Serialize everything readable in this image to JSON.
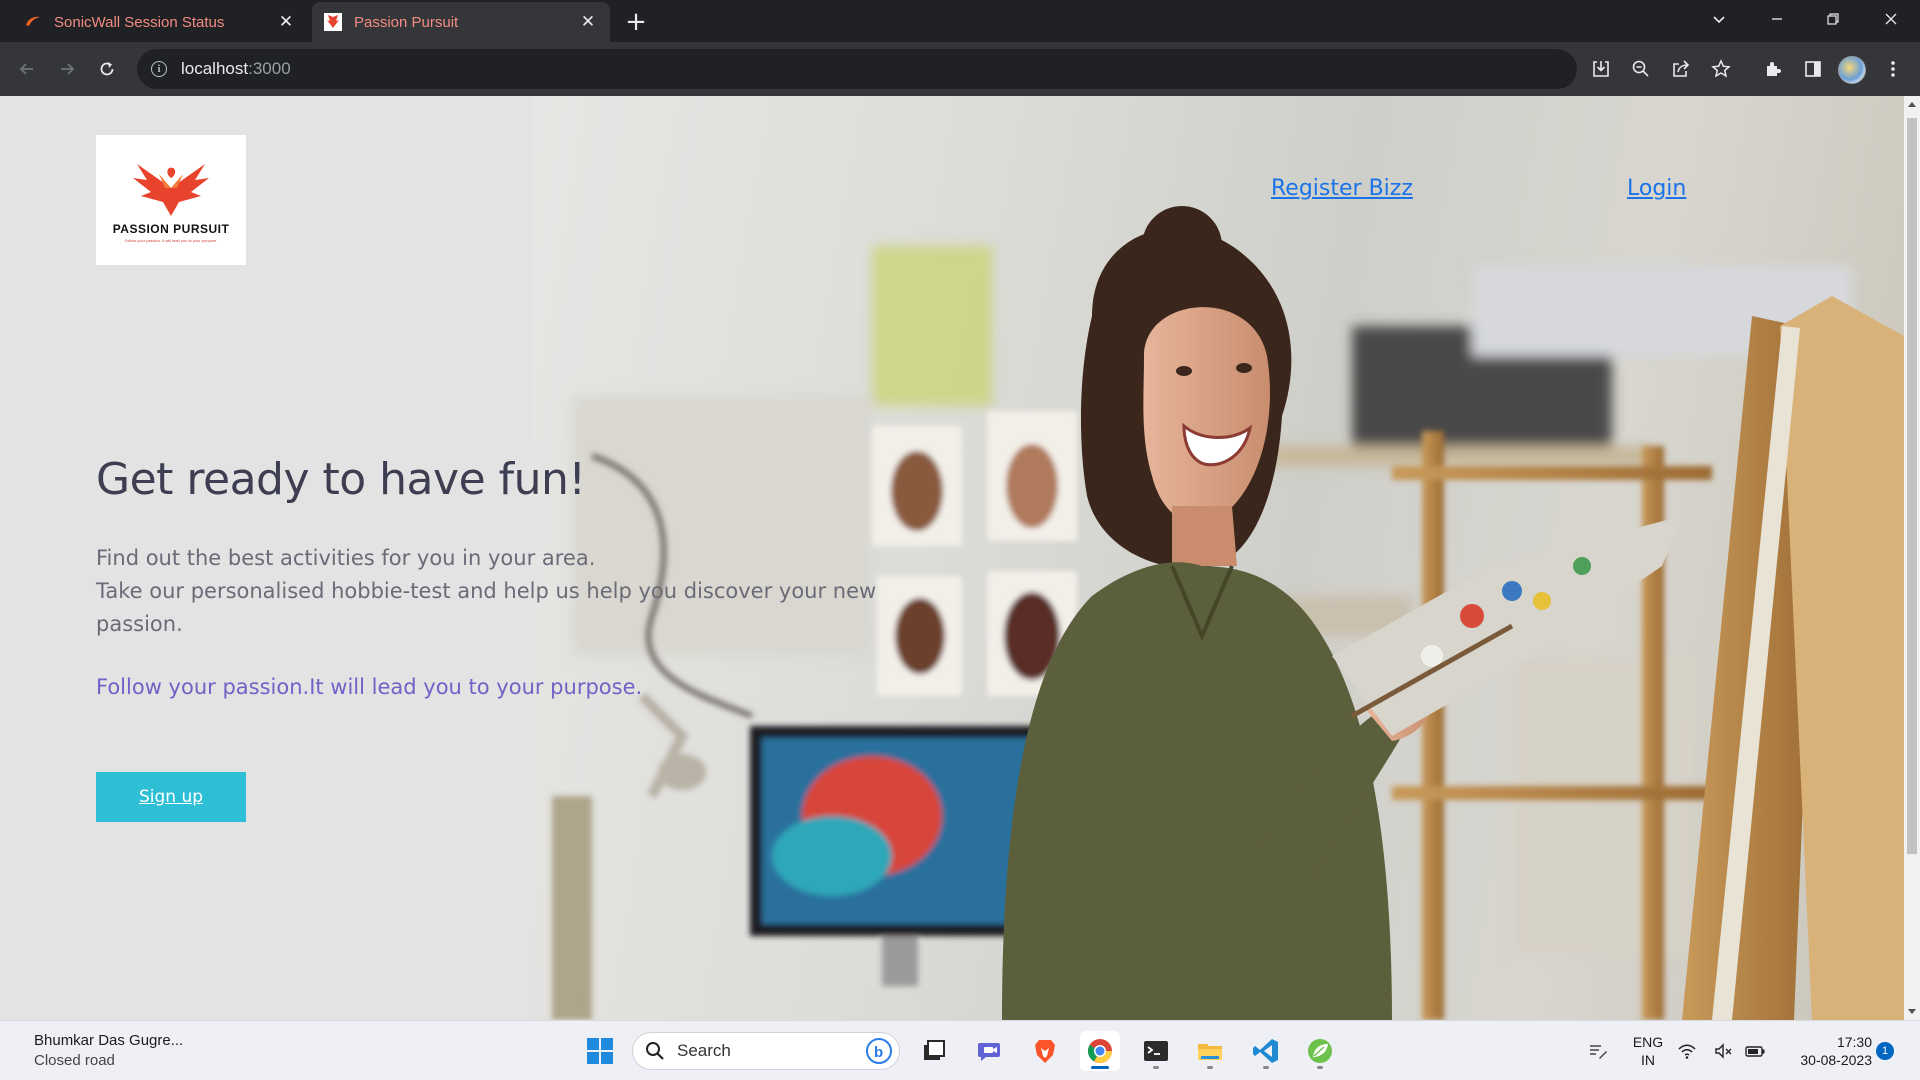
{
  "browser": {
    "tabs": [
      {
        "title": "SonicWall Session Status",
        "active": false,
        "favicon": "sonicwall-icon"
      },
      {
        "title": "Passion Pursuit",
        "active": true,
        "favicon": "passion-pursuit-icon"
      }
    ],
    "address": {
      "host": "localhost",
      "port": ":3000"
    },
    "accent_color": "#f28b82"
  },
  "page": {
    "logo": {
      "brand": "PASSION PURSUIT",
      "tagline": "Follow your passion. It will lead you to your purpose."
    },
    "nav": {
      "register": "Register Bizz",
      "login": "Login"
    },
    "headline": "Get ready to have fun!",
    "description_line1": "Find out the best activities for you in your area.",
    "description_line2": "Take our personalised hobbie-test and help us help you discover your new passion.",
    "tagline": "Follow your passion.It will lead you to your purpose.",
    "signup_label": "Sign up",
    "colors": {
      "headline": "#3e3e52",
      "tagline": "#6f63c7",
      "button": "#2dbfd6",
      "link": "#1a73e8"
    }
  },
  "taskbar": {
    "weather_title": "Bhumkar Das Gugre...",
    "weather_sub": "Closed road",
    "search_label": "Search",
    "language_line1": "ENG",
    "language_line2": "IN",
    "time": "17:30",
    "date": "30-08-2023",
    "notification_count": "1"
  }
}
